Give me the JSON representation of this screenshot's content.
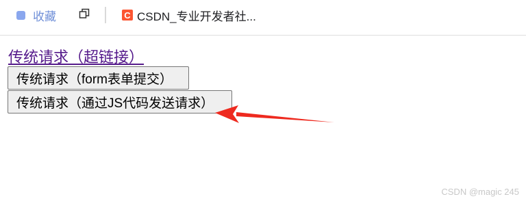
{
  "bookmarks": {
    "favorites_label": "收藏",
    "csdn_logo_letter": "C",
    "csdn_label": "CSDN_专业开发者社..."
  },
  "page": {
    "link_text": "传统请求（超链接）",
    "form_button_label": "传统请求（form表单提交）",
    "js_button_label": "传统请求（通过JS代码发送请求）"
  },
  "watermark": "CSDN @magic 245",
  "colors": {
    "link": "#551a8b",
    "annotation_arrow": "#ee2a1f",
    "csdn_brand": "#fc5531"
  }
}
